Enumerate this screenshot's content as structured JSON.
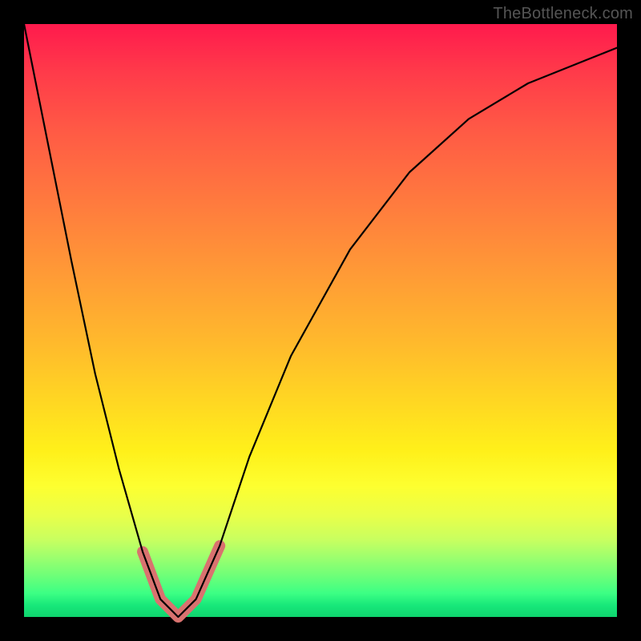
{
  "watermark": "TheBottleneck.com",
  "chart_data": {
    "type": "line",
    "title": "",
    "xlabel": "",
    "ylabel": "",
    "xlim": [
      0,
      1
    ],
    "ylim": [
      0,
      1
    ],
    "note": "Axes unlabeled; values are normalized. Background encodes bottleneck: red (high) at top, green (low) at bottom. Curve minimum near x≈0.26.",
    "series": [
      {
        "name": "bottleneck-curve",
        "x": [
          0.0,
          0.04,
          0.08,
          0.12,
          0.16,
          0.2,
          0.23,
          0.26,
          0.29,
          0.33,
          0.38,
          0.45,
          0.55,
          0.65,
          0.75,
          0.85,
          0.95,
          1.0
        ],
        "y": [
          1.0,
          0.8,
          0.6,
          0.41,
          0.25,
          0.11,
          0.03,
          0.0,
          0.03,
          0.12,
          0.27,
          0.44,
          0.62,
          0.75,
          0.84,
          0.9,
          0.94,
          0.96
        ]
      }
    ],
    "highlight": {
      "name": "trough-marker",
      "x": [
        0.2,
        0.23,
        0.26,
        0.29,
        0.33
      ],
      "y": [
        0.11,
        0.03,
        0.0,
        0.03,
        0.12
      ],
      "color": "#d9726f"
    },
    "gradient_stops": [
      {
        "pos": 0.0,
        "color": "#ff1a4d"
      },
      {
        "pos": 0.3,
        "color": "#ff7a3e"
      },
      {
        "pos": 0.64,
        "color": "#ffd822"
      },
      {
        "pos": 0.86,
        "color": "#c8ff60"
      },
      {
        "pos": 1.0,
        "color": "#0fd46e"
      }
    ]
  }
}
